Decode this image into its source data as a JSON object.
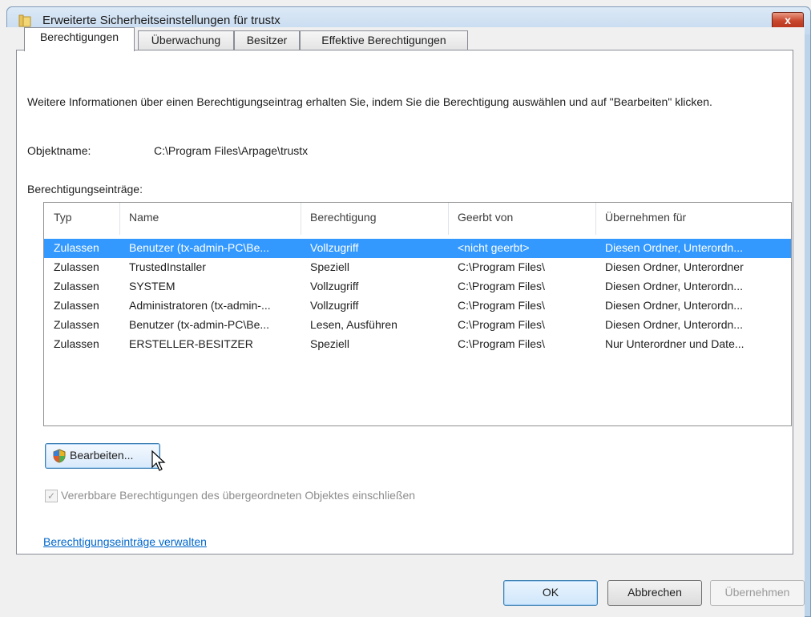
{
  "window": {
    "title": "Erweiterte Sicherheitseinstellungen für trustx",
    "close_label": "x"
  },
  "tabs": [
    {
      "label": "Berechtigungen",
      "active": true
    },
    {
      "label": "Überwachung",
      "active": false
    },
    {
      "label": "Besitzer",
      "active": false
    },
    {
      "label": "Effektive Berechtigungen",
      "active": false
    }
  ],
  "info_text": "Weitere Informationen über einen Berechtigungseintrag erhalten Sie, indem Sie die Berechtigung auswählen und auf \"Bearbeiten\" klicken.",
  "object": {
    "label": "Objektname:",
    "value": "C:\\Program Files\\Arpage\\trustx"
  },
  "entries_label": "Berechtigungseinträge:",
  "list": {
    "headers": [
      "Typ",
      "Name",
      "Berechtigung",
      "Geerbt von",
      "Übernehmen für"
    ],
    "rows": [
      {
        "typ": "Zulassen",
        "name": "Benutzer (tx-admin-PC\\Be...",
        "perm": "Vollzugriff",
        "inherited": "<nicht geerbt>",
        "applies": "Diesen Ordner, Unterordn...",
        "selected": true
      },
      {
        "typ": "Zulassen",
        "name": "TrustedInstaller",
        "perm": "Speziell",
        "inherited": "C:\\Program Files\\",
        "applies": "Diesen Ordner, Unterordner",
        "selected": false
      },
      {
        "typ": "Zulassen",
        "name": "SYSTEM",
        "perm": "Vollzugriff",
        "inherited": "C:\\Program Files\\",
        "applies": "Diesen Ordner, Unterordn...",
        "selected": false
      },
      {
        "typ": "Zulassen",
        "name": "Administratoren (tx-admin-...",
        "perm": "Vollzugriff",
        "inherited": "C:\\Program Files\\",
        "applies": "Diesen Ordner, Unterordn...",
        "selected": false
      },
      {
        "typ": "Zulassen",
        "name": "Benutzer (tx-admin-PC\\Be...",
        "perm": "Lesen, Ausführen",
        "inherited": "C:\\Program Files\\",
        "applies": "Diesen Ordner, Unterordn...",
        "selected": false
      },
      {
        "typ": "Zulassen",
        "name": "ERSTELLER-BESITZER",
        "perm": "Speziell",
        "inherited": "C:\\Program Files\\",
        "applies": "Nur Unterordner und Date...",
        "selected": false
      }
    ]
  },
  "edit_button": "Bearbeiten...",
  "inherit_checkbox": {
    "label": "Vererbbare Berechtigungen des übergeordneten Objektes einschließen",
    "checked": true,
    "enabled": false
  },
  "manage_link": "Berechtigungseinträge verwalten",
  "buttons": {
    "ok": "OK",
    "cancel": "Abbrechen",
    "apply": "Übernehmen"
  },
  "colors": {
    "selection": "#3399ff",
    "link": "#0066cc",
    "close_button": "#c8472c"
  }
}
